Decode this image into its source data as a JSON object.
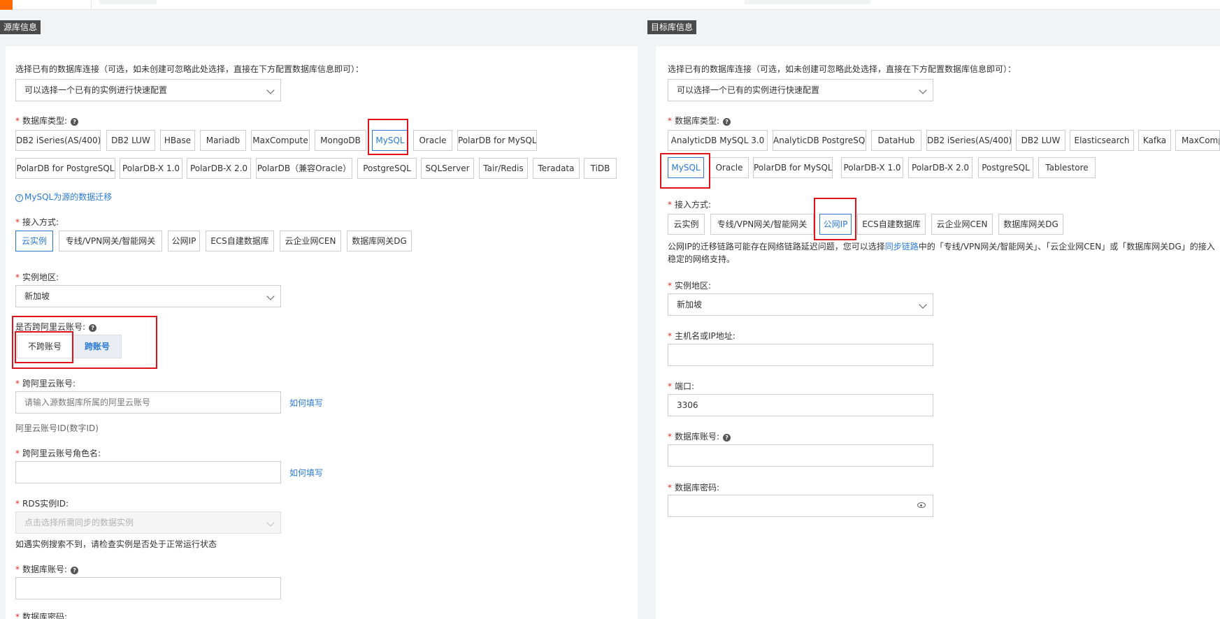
{
  "source": {
    "tag": "源库信息",
    "existing_label": "选择已有的数据库连接（可选，如未创建可忽略此处选择，直接在下方配置数据库信息即可）：",
    "existing_placeholder": "可以选择一个已有的实例进行快速配置",
    "db_type_label": "数据库类型:",
    "db_types_row1": [
      "DB2 iSeries(AS/400)",
      "DB2 LUW",
      "HBase",
      "Mariadb",
      "MaxCompute",
      "MongoDB",
      "MySQL",
      "Oracle",
      "PolarDB for MySQL"
    ],
    "db_types_row2": [
      "PolarDB for PostgreSQL",
      "PolarDB-X 1.0",
      "PolarDB-X 2.0",
      "PolarDB（兼容Oracle）",
      "PostgreSQL",
      "SQLServer",
      "Tair/Redis",
      "Teradata",
      "TiDB"
    ],
    "migration_link": "MySQL为源的数据迁移",
    "access_label": "接入方式:",
    "access_options": [
      "云实例",
      "专线/VPN网关/智能网关",
      "公网IP",
      "ECS自建数据库",
      "云企业网CEN",
      "数据库网关DG"
    ],
    "region_label": "实例地区:",
    "region_value": "新加坡",
    "cross_label": "是否跨阿里云账号:",
    "cross_options": [
      "不跨账号",
      "跨账号"
    ],
    "cross_account_label": "跨阿里云账号:",
    "cross_account_placeholder": "请输入源数据库所属的阿里云账号",
    "how_to_fill": "如何填写",
    "account_id_hint": "阿里云账号ID(数字ID)",
    "role_label": "跨阿里云账号角色名:",
    "how_to_fill_2": "如何填写",
    "rds_label": "RDS实例ID:",
    "rds_placeholder": "点击选择所需同步的数据实例",
    "rds_hint": "如遇实例搜索不到，请检查实例是否处于正常运行状态",
    "db_account_label": "数据库账号:",
    "db_password_label": "数据库密码:"
  },
  "target": {
    "tag": "目标库信息",
    "existing_label": "选择已有的数据库连接（可选，如未创建可忽略此处选择，直接在下方配置数据库信息即可）：",
    "existing_placeholder": "可以选择一个已有的实例进行快速配置",
    "db_type_label": "数据库类型:",
    "db_types_row1": [
      "AnalyticDB MySQL 3.0",
      "AnalyticDB PostgreSQL",
      "DataHub",
      "DB2 iSeries(AS/400)",
      "DB2 LUW",
      "Elasticsearch",
      "Kafka",
      "MaxCompute"
    ],
    "db_types_row2": [
      "MySQL",
      "Oracle",
      "PolarDB for MySQL",
      "PolarDB-X 1.0",
      "PolarDB-X 2.0",
      "PostgreSQL",
      "Tablestore"
    ],
    "access_label": "接入方式:",
    "access_options": [
      "云实例",
      "专线/VPN网关/智能网关",
      "公网IP",
      "ECS自建数据库",
      "云企业网CEN",
      "数据库网关DG"
    ],
    "note_part1": "公网IP的迁移链路可能存在网络链路延迟问题，您可以选择",
    "note_link": "同步链路",
    "note_part2": "中的「专线/VPN网关/智能网关」、「云企业网CEN」或「数据库网关DG」的接入",
    "note_line2": "稳定的网络支持。",
    "region_label": "实例地区:",
    "region_value": "新加坡",
    "host_label": "主机名或IP地址:",
    "port_label": "端口:",
    "port_value": "3306",
    "db_account_label": "数据库账号:",
    "db_password_label": "数据库密码:"
  },
  "colors": {
    "accent": "#2a7ad5",
    "highlight": "#e0131a",
    "required": "#d93026",
    "brand": "#ff6a00"
  }
}
